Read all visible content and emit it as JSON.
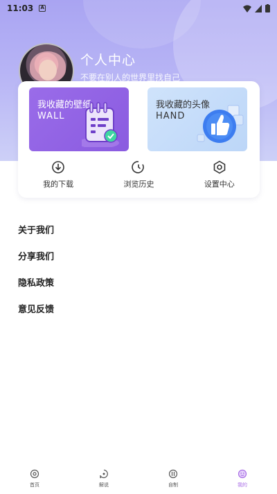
{
  "status_bar": {
    "time": "11:03",
    "badge": "A"
  },
  "profile": {
    "name": "个人中心",
    "motto": "不要在别人的世界里找自己"
  },
  "tiles": {
    "wallpaper": {
      "title": "我收藏的壁纸",
      "subtitle": "WALL"
    },
    "avatar": {
      "title": "我收藏的头像",
      "subtitle": "HAND"
    }
  },
  "actions": [
    {
      "label": "我的下载",
      "icon": "download-icon"
    },
    {
      "label": "浏览历史",
      "icon": "history-icon"
    },
    {
      "label": "设置中心",
      "icon": "settings-icon"
    }
  ],
  "menu": [
    {
      "label": "关于我们"
    },
    {
      "label": "分享我们"
    },
    {
      "label": "隐私政策"
    },
    {
      "label": "意见反馈"
    }
  ],
  "tabs": [
    {
      "label": "首页",
      "icon": "home-icon",
      "active": false
    },
    {
      "label": "解说",
      "icon": "explain-icon",
      "active": false
    },
    {
      "label": "自制",
      "icon": "create-icon",
      "active": false
    },
    {
      "label": "我的",
      "icon": "profile-icon",
      "active": true
    }
  ],
  "colors": {
    "hero_bg": "#b3aff4",
    "wall_tile": "#9065e6",
    "hand_tile": "#c8dcf9",
    "active_tab": "#a86ce6"
  }
}
